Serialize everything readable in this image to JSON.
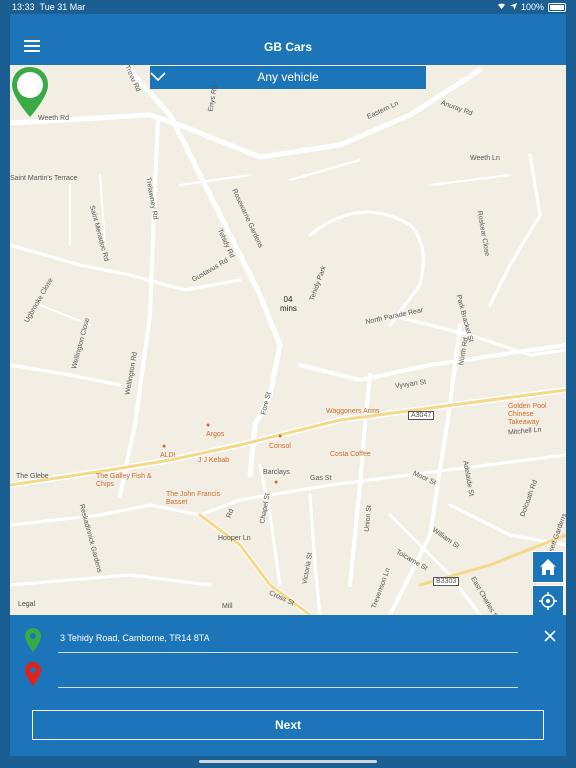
{
  "status": {
    "time": "13:33",
    "date": "Tue 31 Mar",
    "battery": "100%"
  },
  "header": {
    "title": "GB Cars",
    "menu_icon": "hamburger-menu-icon"
  },
  "vehicle_select": {
    "value": "Any vehicle"
  },
  "eta": {
    "value": "04",
    "unit": "mins"
  },
  "map": {
    "legal": "Legal",
    "streets": [
      "Weeth Rd",
      "Eastern Ln",
      "Trelawney Rd",
      "Tehidy Rd",
      "Wellington Rd",
      "Gustavus Rd",
      "North Parade Rear",
      "Vyvyan St",
      "North Rd",
      "Fore St",
      "Chapel St",
      "Cross St",
      "Victoria St",
      "Union St",
      "Gas St",
      "Mitchell Ln",
      "Moor St",
      "Trevenson Ln",
      "The Glebe",
      "Hooper Ln",
      "Ugbrooke Close",
      "Wellington Close",
      "Saint Meriadoc Rd",
      "Saint Martin's Terrace",
      "Reskadinnick Gardens",
      "Rosewarne Gardens",
      "Roskear Close",
      "Park Bracket St",
      "Adelaide St",
      "Tolcarne St",
      "William St",
      "Tehidy Park",
      "Enys Rd",
      "Anuray Rd",
      "Bassett Gardens",
      "East Charles St",
      "Dolcoath Rd",
      "Trevu Rd",
      "Weeth Ln",
      "Rd",
      "Mill"
    ],
    "roads": [
      "A3047",
      "B3303"
    ],
    "pois": [
      "Argos",
      "ALDI",
      "J J Kebab",
      "Consol",
      "Barclays",
      "Waggoners Arms",
      "Costa Coffee",
      "The Galley Fish & Chips",
      "The John Francis Basset",
      "Golden Pool Chinese Takeaway"
    ]
  },
  "pickup": {
    "value": "3 Tehidy Road, Camborne, TR14 8TA"
  },
  "dropoff": {
    "value": ""
  },
  "actions": {
    "next_label": "Next"
  },
  "colors": {
    "brand": "#1b75b8",
    "pickup_pin": "#3aaa47",
    "dropoff_pin": "#e2231a"
  }
}
